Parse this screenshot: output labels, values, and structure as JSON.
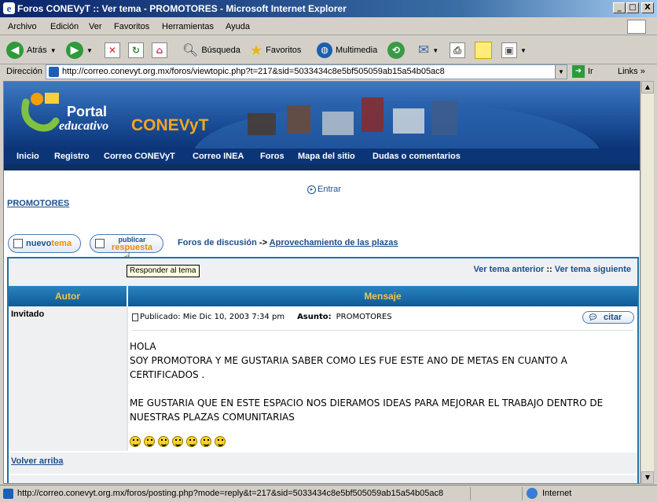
{
  "window": {
    "title": "Foros CONEVyT :: Ver tema - PROMOTORES - Microsoft Internet Explorer",
    "min": "_",
    "max": "□",
    "close": "X"
  },
  "menu": {
    "items": [
      "Archivo",
      "Edición",
      "Ver",
      "Favoritos",
      "Herramientas",
      "Ayuda"
    ]
  },
  "toolbar": {
    "back": "Atrás",
    "search": "Búsqueda",
    "favorites": "Favoritos",
    "media": "Multimedia"
  },
  "address": {
    "label": "Dirección",
    "url": "http://correo.conevyt.org.mx/foros/viewtopic.php?t=217&sid=5033434c8e5bf505059ab15a54b05ac8",
    "go": "Ir",
    "links": "Links"
  },
  "banner": {
    "portal": "Portal",
    "educativo": "educativo",
    "brand": "CONEVyT"
  },
  "nav": {
    "items": [
      "Inicio",
      "Registro",
      "Correo CONEVyT",
      "Correo INEA",
      "Foros",
      "Mapa del sitio",
      "Dudas o comentarios"
    ]
  },
  "page": {
    "login": "Entrar",
    "forum_name": "PROMOTORES",
    "new_topic_a": "nuevo",
    "new_topic_b": "tema",
    "reply_a": "publicar",
    "reply_b": "respuesta",
    "breadcrumb_root": "Foros de discusión",
    "breadcrumb_sep": "->",
    "breadcrumb_forum": "Aprovechamiento de las plazas",
    "tooltip": "Responder al tema",
    "prev_topic": "Ver tema anterior",
    "sep": "::",
    "next_topic": "Ver tema siguiente"
  },
  "table": {
    "col_author": "Autor",
    "col_message": "Mensaje"
  },
  "post": {
    "author": "Invitado",
    "posted": "Publicado: Mie Dic 10, 2003 7:34 pm",
    "subject_label": "Asunto:",
    "subject": "PROMOTORES",
    "quote": "citar",
    "body": [
      "HOLA",
      "SOY PROMOTORA Y ME GUSTARIA SABER COMO LES FUE ESTE ANO DE METAS EN CUANTO A",
      "CERTIFICADOS .",
      "ME GUSTARIA QUE EN ESTE ESPACIO NOS DIERAMOS IDEAS PARA MEJORAR EL TRABAJO DENTRO DE",
      "NUESTRAS PLAZAS COMUNITARIAS"
    ],
    "back_to_top": "Volver arriba"
  },
  "status": {
    "url": "http://correo.conevyt.org.mx/foros/posting.php?mode=reply&t=217&sid=5033434c8e5bf505059ab15a54b05ac8",
    "zone": "Internet"
  }
}
